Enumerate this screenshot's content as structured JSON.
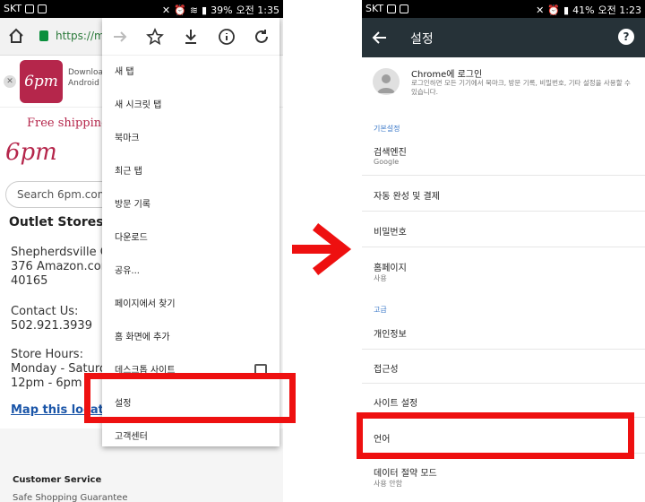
{
  "left": {
    "status": {
      "carrier": "SKT",
      "battery": "39%",
      "time": "오전 1:35"
    },
    "url": "https://m.6",
    "banner": {
      "logo_text": "6pm",
      "title": "Download",
      "subtitle": "Android",
      "close": "✕"
    },
    "free_shipping": "Free shipping a",
    "site_logo": "6pm",
    "search_placeholder": "Search 6pm.com",
    "outlet_title": "Outlet Stores",
    "address": [
      "Shepherdsville Ou",
      "376 Amazon.con",
      "40165"
    ],
    "contact": [
      "Contact Us:",
      "502.921.3939"
    ],
    "hours": [
      "Store Hours:",
      "Monday - Saturda",
      "12pm - 6pm ("
    ],
    "map_link": "Map this locatio",
    "footer": {
      "customer_service": "Customer Service",
      "safe_shopping": "Safe Shopping Guarantee"
    },
    "menu": {
      "items": [
        "새 탭",
        "새 시크릿 탭",
        "북마크",
        "최근 탭",
        "방문 기록",
        "다운로드",
        "공유...",
        "페이지에서 찾기",
        "홈 화면에 추가",
        "데스크톱 사이트",
        "설정",
        "고객센터"
      ]
    }
  },
  "right": {
    "status": {
      "carrier": "SKT",
      "battery": "41%",
      "time": "오전 1:23"
    },
    "toolbar_title": "설정",
    "help": "?",
    "account": {
      "title": "Chrome에 로그인",
      "desc": "로그인하면 모든 기기에서 북마크, 방문 기록, 비밀번호, 기타 설정을 사용할 수 있습니다."
    },
    "section_basic": "기본설정",
    "search_engine": {
      "title": "검색엔진",
      "sub": "Google"
    },
    "autofill": "자동 완성 및 결제",
    "passwords": "비밀번호",
    "homepage": {
      "title": "홈페이지",
      "sub": "사용"
    },
    "section_advanced": "고급",
    "privacy": "개인정보",
    "accessibility": "접근성",
    "site_settings": "사이트 설정",
    "language": "언어",
    "data_saver": {
      "title": "데이터 절약 모드",
      "sub": "사용 안함"
    }
  },
  "colors": {
    "highlight": "#ee1010",
    "toolbar": "#263238",
    "brand": "#b5264b",
    "section": "#3b78c8"
  }
}
